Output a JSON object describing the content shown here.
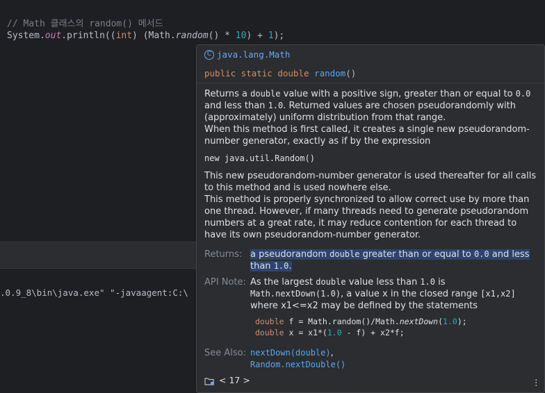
{
  "editor": {
    "comment": "// Math 클래스의 random() 메서드",
    "code": {
      "prefix": "System.",
      "out": "out",
      "println_open": ".println((",
      "int_kw": "int",
      "cast_close": ") (Math.",
      "random_fn": "random",
      "mid": "() * ",
      "num10": "10",
      "plus": ") + ",
      "num1": "1",
      "end": ");"
    }
  },
  "run_panel": {
    "command_line": ".0.9_8\\bin\\java.exe\" \"-javaagent:C:\\"
  },
  "doc": {
    "class_icon": "C",
    "class_name": "java.lang.Math",
    "signature": {
      "modifiers": "public static double ",
      "method": "random",
      "parens": "()"
    },
    "para1": {
      "t1": "Returns a ",
      "c1": "double",
      "t2": " value with a positive sign, greater than or equal to ",
      "c2": "0.0",
      "t3": " and less than ",
      "c3": "1.0",
      "t4": ". Returned values are chosen pseudorandomly with (approximately) uniform distribution from that range."
    },
    "para2": "When this method is first called, it creates a single new pseudorandom-number generator, exactly as if by the expression",
    "expr": "new java.util.Random()",
    "para3": "This new pseudorandom-number generator is used thereafter for all calls to this method and is used nowhere else.",
    "para4": "This method is properly synchronized to allow correct use by more than one thread. However, if many threads need to generate pseudorandom numbers at a great rate, it may reduce contention for each thread to have its own pseudorandom-number generator.",
    "returns": {
      "label": "Returns:",
      "t1": "a pseudorandom ",
      "c1": "double",
      "t2": " greater than or equal to ",
      "c2": "0.0",
      "t3": " and less than ",
      "c3": "1.0",
      "t4": "."
    },
    "api_note": {
      "label": "API Note:",
      "t1": "As the largest ",
      "c1": "double",
      "t2": " value less than ",
      "c2": "1.0",
      "t3": " is ",
      "c3": "Math.nextDown(1.0)",
      "t4": ", a value x in the closed range ",
      "c4": "[x1,x2]",
      "t5": " where ",
      "c5": "x1<=x2",
      "t6": " may be defined by the statements",
      "code1": {
        "kw": "double",
        "rest_a": " f = Math.random()/Math.",
        "it": "nextDown",
        "rest_b": "(",
        "num": "1.0",
        "rest_c": ");"
      },
      "code2": {
        "kw": "double",
        "rest_a": " x = x1*(",
        "num": "1.0",
        "rest_b": " - f) + x2*f;"
      }
    },
    "see_also": {
      "label": "See Also:",
      "link1": "nextDown(double)",
      "sep": ",",
      "link2": "Random.nextDouble()"
    },
    "footer": {
      "nav_text": "< 17 >"
    }
  },
  "colors": {
    "editor_bg": "#1e1f22",
    "popup_bg": "#2b2d30",
    "keyword": "#cf8e6d",
    "link": "#56a8f5",
    "number": "#2aacb8",
    "selection": "#2e436e"
  }
}
